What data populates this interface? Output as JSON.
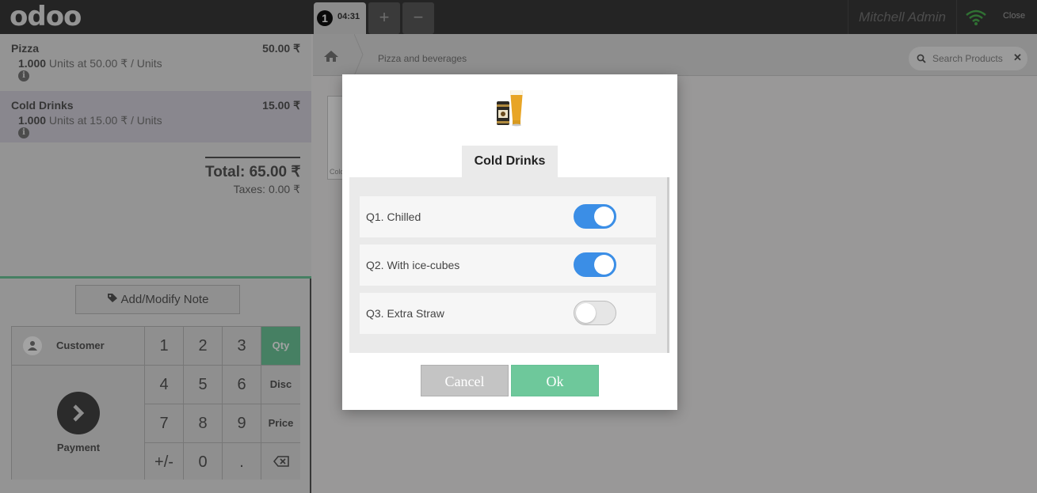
{
  "topbar": {
    "logo": "odoo",
    "order_number": "1",
    "order_time": "04:31",
    "add_order": "+",
    "remove_order": "−",
    "user": "Mitchell Admin",
    "close_label": "Close"
  },
  "order": {
    "lines": [
      {
        "name": "Pizza",
        "price": "50.00 ₹",
        "qty": "1.000",
        "detail": " Units at 50.00 ₹ / Units"
      },
      {
        "name": "Cold Drinks",
        "price": "15.00 ₹",
        "qty": "1.000",
        "detail": " Units at 15.00 ₹ / Units"
      }
    ],
    "total": "Total: 65.00 ₹",
    "taxes": "Taxes: 0.00 ₹"
  },
  "actions": {
    "note_label": "Add/Modify Note",
    "customer_label": "Customer",
    "payment_label": "Payment"
  },
  "numpad": {
    "keys": [
      "1",
      "2",
      "3",
      "4",
      "5",
      "6",
      "7",
      "8",
      "9",
      "+/-",
      "0",
      "."
    ],
    "modes": [
      "Qty",
      "Disc",
      "Price"
    ],
    "active_mode": "Qty"
  },
  "products": {
    "breadcrumb": "Pizza and beverages",
    "search_placeholder": "Search Products",
    "card_label": "Cold"
  },
  "modal": {
    "product_name": "Cold Drinks",
    "questions": [
      {
        "label": "Q1. Chilled",
        "checked": true
      },
      {
        "label": "Q2. With ice-cubes",
        "checked": true
      },
      {
        "label": "Q3. Extra Straw",
        "checked": false
      }
    ],
    "cancel_label": "Cancel",
    "ok_label": "Ok"
  },
  "colors": {
    "accent_green": "#6ec89b",
    "toggle_on": "#3b8ee6",
    "topbar": "#393939"
  }
}
